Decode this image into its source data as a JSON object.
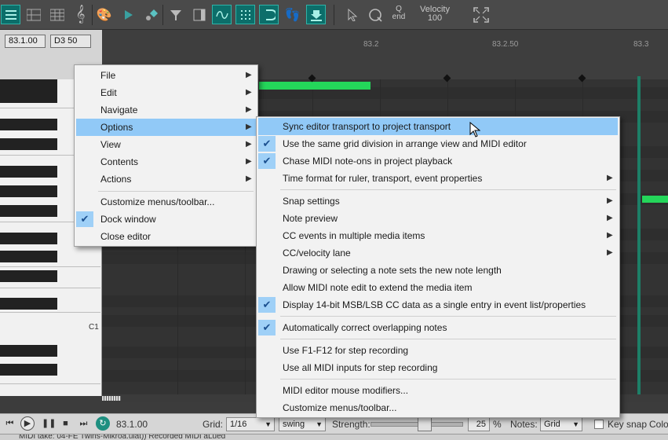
{
  "toolbar": {
    "quantize_label": "Q",
    "quantize_sub": "end",
    "velocity_label": "Velocity",
    "velocity_value": "100"
  },
  "position": {
    "time": "83.1.00",
    "note": "D3  50"
  },
  "ruler": {
    "labels": [
      "83.2",
      "83.2.50",
      "83.3"
    ]
  },
  "piano": {
    "c1_label": "C1"
  },
  "main_menu": {
    "items": [
      {
        "label": "File"
      },
      {
        "label": "Edit"
      },
      {
        "label": "Navigate"
      },
      {
        "label": "Options"
      },
      {
        "label": "View"
      },
      {
        "label": "Contents"
      },
      {
        "label": "Actions"
      },
      {
        "label": "Customize menus/toolbar..."
      },
      {
        "label": "Dock window"
      },
      {
        "label": "Close editor"
      }
    ]
  },
  "options_menu": {
    "items": [
      {
        "label": "Sync editor transport to project transport"
      },
      {
        "label": "Use the same grid division in arrange view and MIDI editor"
      },
      {
        "label": "Chase MIDI note-ons in project playback"
      },
      {
        "label": "Time format for ruler, transport, event properties"
      },
      {
        "label": "Snap settings"
      },
      {
        "label": "Note preview"
      },
      {
        "label": "CC events in multiple media items"
      },
      {
        "label": "CC/velocity lane"
      },
      {
        "label": "Drawing or selecting a note sets the new note length"
      },
      {
        "label": "Allow MIDI note edit to extend the media item"
      },
      {
        "label": "Display 14-bit MSB/LSB CC data as a single entry in event list/properties"
      },
      {
        "label": "Automatically correct overlapping notes"
      },
      {
        "label": "Use F1-F12 for step recording"
      },
      {
        "label": "Use all MIDI inputs for step recording"
      },
      {
        "label": "MIDI editor mouse modifiers..."
      },
      {
        "label": "Customize menus/toolbar..."
      }
    ]
  },
  "bottom": {
    "time": "83.1.00",
    "grid_label": "Grid:",
    "grid_value": "1/16",
    "swing_value": "swing",
    "strength_label": "Strength:",
    "strength_value": "25",
    "percent": "%",
    "notes_label": "Notes:",
    "notes_value": "Grid",
    "keysnap_label": "Key snap",
    "color_label": "Colo"
  },
  "status": {
    "text": "MIDI take: 04-FE Twins-Mikroa.ulat)) Recorded MIDI aLued"
  },
  "colors": {
    "accent": "#91c9f7",
    "note_green": "#24d65a",
    "toolbar_active": "#0c6e6a"
  }
}
